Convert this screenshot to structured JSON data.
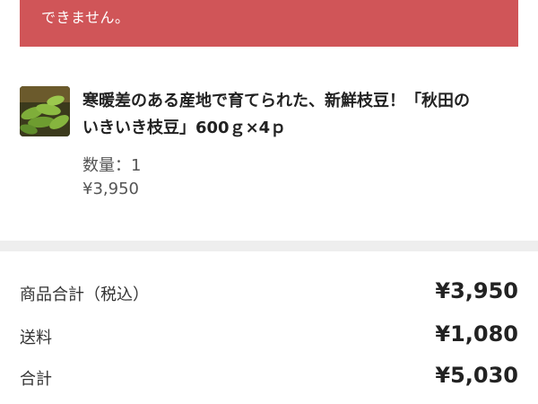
{
  "alert": {
    "text": "できません。",
    "color": "#d05558"
  },
  "product": {
    "image_icon": "edamame-thumbnail",
    "title_line1": "寒暖差のある産地で育てられた、新鮮枝豆！「秋田の",
    "title_line2": "いきいき枝豆」600ｇ×4ｐ",
    "quantity": "数量：1",
    "price": "¥3,950"
  },
  "summary": {
    "rows": [
      {
        "label": "商品合計（税込）",
        "value": "¥3,950"
      },
      {
        "label": "送料",
        "value": "¥1,080"
      },
      {
        "label": "合計",
        "value": "¥5,030"
      }
    ]
  }
}
